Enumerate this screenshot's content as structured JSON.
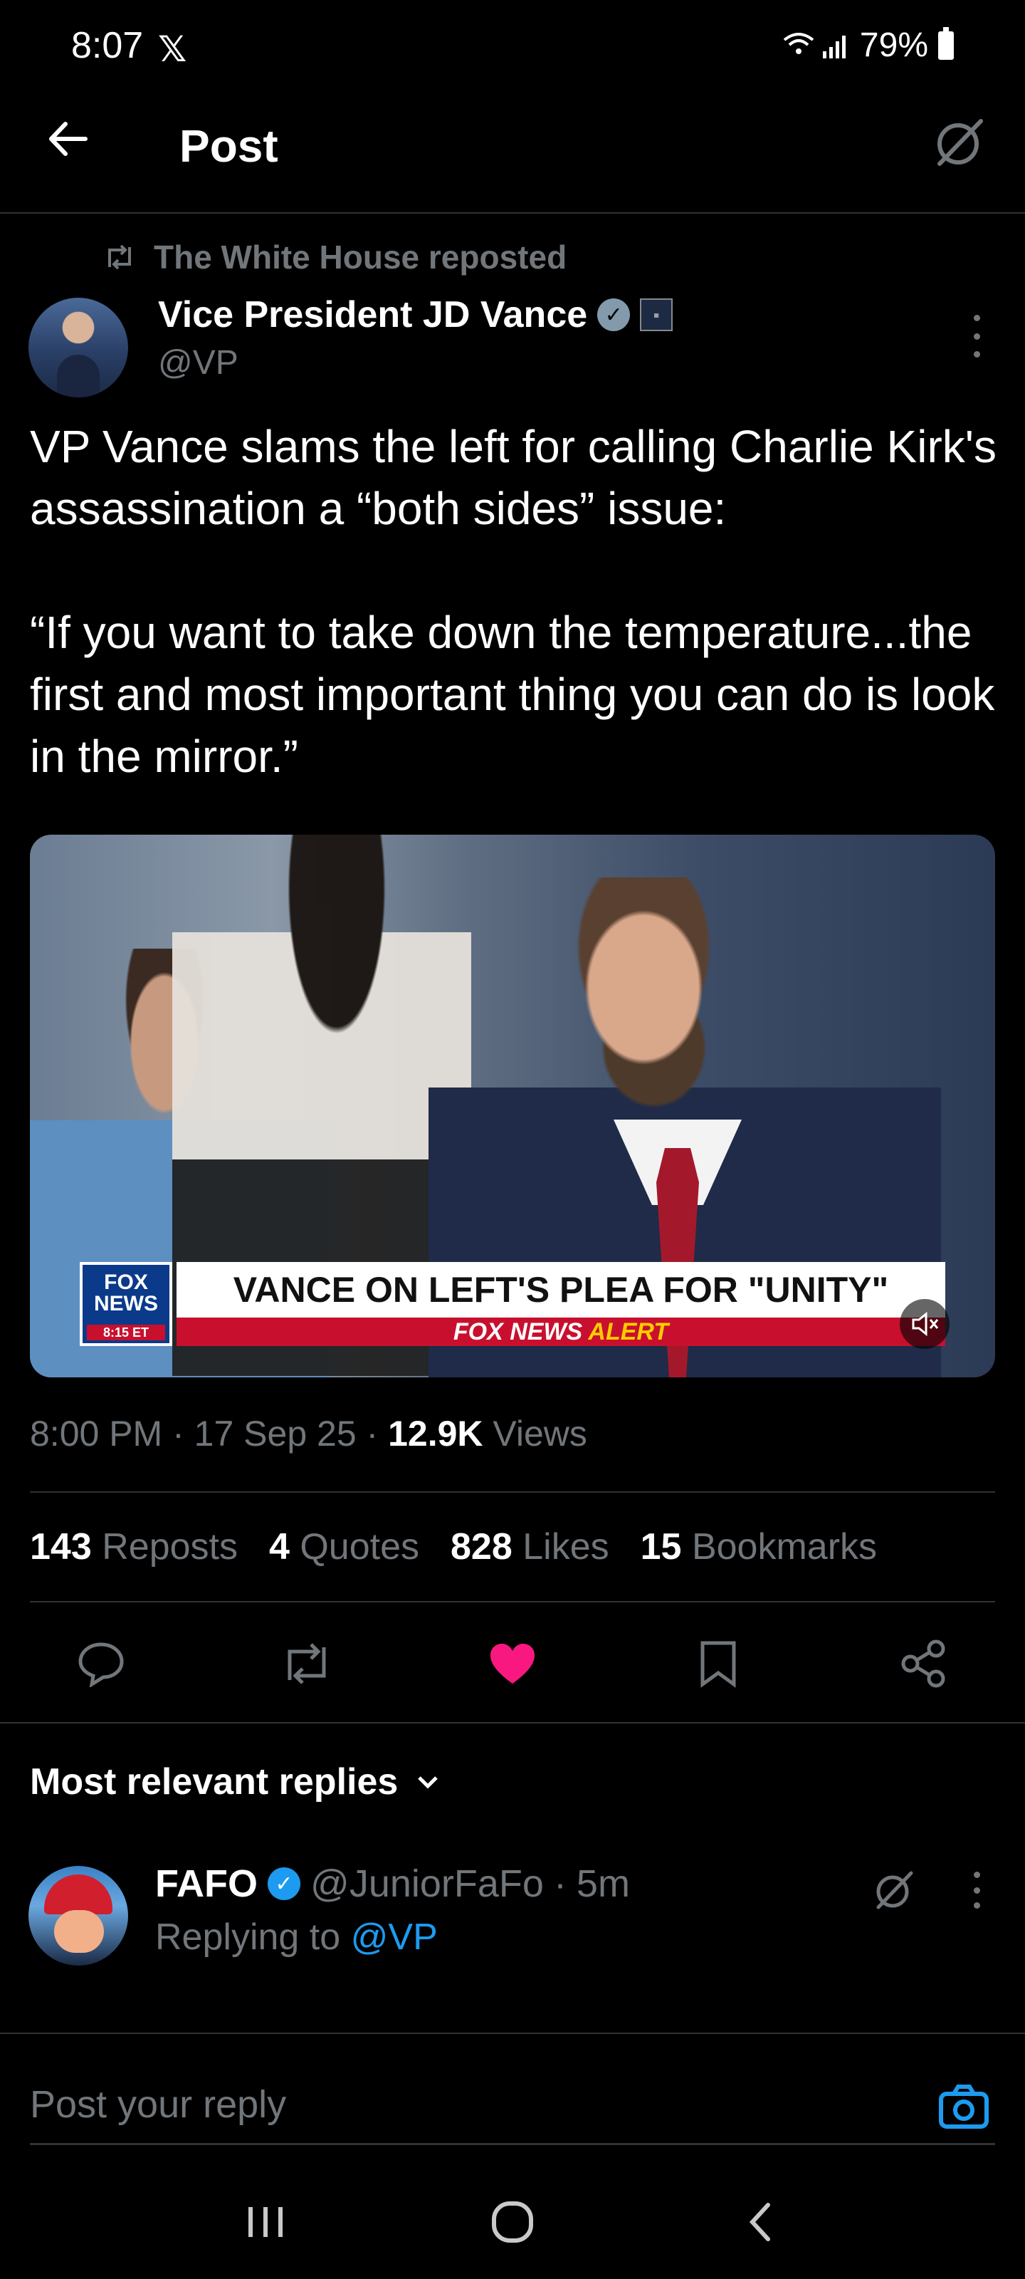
{
  "status_bar": {
    "time": "8:07",
    "app_icon": "x-logo-icon",
    "battery": "79%",
    "signal_icon": "wifi-signal-icon"
  },
  "header": {
    "title": "Post",
    "back_icon": "arrow-left-icon",
    "grok_icon": "grok-icon"
  },
  "post": {
    "repost_label": "The White House reposted",
    "author_name": "Vice President JD Vance",
    "author_handle": "@VP",
    "text": "VP Vance slams the left for calling Charlie Kirk's assassination a “both sides” issue:\n\n“If you want to take down the temperature...the first and most important thing you can do is look in the mirror.”",
    "media": {
      "chyron_main": "VANCE ON LEFT'S PLEA FOR \"UNITY\"",
      "chyron_sub_a": "FOX NEWS",
      "chyron_sub_b": "ALERT",
      "fox_logo_top": "FOX",
      "fox_logo_bottom": "NEWS",
      "fox_time": "8:15 ET"
    },
    "time": "8:00 PM",
    "date": "17 Sep 25",
    "views_count": "12.9K",
    "views_label": "Views",
    "stats": [
      {
        "count": "143",
        "label": "Reposts"
      },
      {
        "count": "4",
        "label": "Quotes"
      },
      {
        "count": "828",
        "label": "Likes"
      },
      {
        "count": "15",
        "label": "Bookmarks"
      }
    ],
    "like_color": "#f91880"
  },
  "replies": {
    "heading": "Most relevant replies",
    "items": [
      {
        "name": "FAFO",
        "handle": "@JuniorFaFo",
        "age": "5m",
        "replying_prefix": "Replying to",
        "replying_to": "@VP"
      }
    ]
  },
  "compose": {
    "placeholder": "Post your reply"
  },
  "colors": {
    "accent": "#1d9bf0",
    "background": "#000000",
    "muted": "#71767b"
  }
}
